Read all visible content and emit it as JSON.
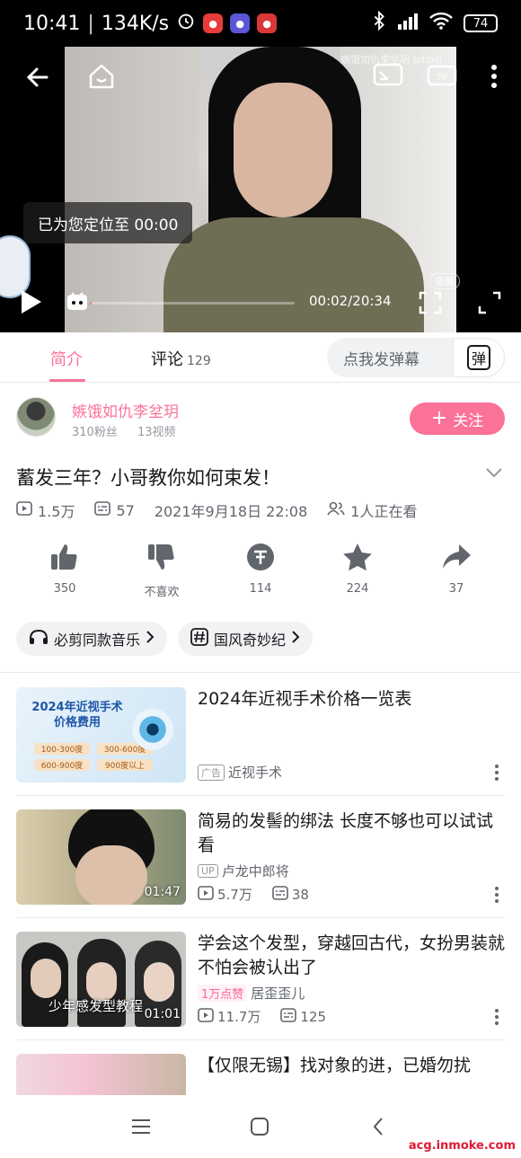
{
  "status_bar": {
    "time": "10:41",
    "speed": "134K/s",
    "battery": "74"
  },
  "player": {
    "watermark": "嫉饿如仇李坌玥 bilibili",
    "toast": "已为您定位至 00:00",
    "time_display": "00:02/20:34",
    "progress": 0.002,
    "portrait_label": "竖屏"
  },
  "tabs": {
    "intro": "简介",
    "comments": "评论",
    "comments_count": "129",
    "danmaku_placeholder": "点我发弹幕",
    "danmaku_button": "弹"
  },
  "uploader": {
    "name": "嫉饿如仇李坌玥",
    "fans": "310粉丝",
    "videos": "13视频",
    "follow_label": "关注"
  },
  "video_info": {
    "title": "蓄发三年？小哥教你如何束发！",
    "views": "1.5万",
    "danmaku": "57",
    "date": "2021年9月18日 22:08",
    "watching": "1人正在看"
  },
  "actions": [
    {
      "icon": "thumbs-up-icon",
      "label": "350"
    },
    {
      "icon": "thumbs-down-icon",
      "label": "不喜欢"
    },
    {
      "icon": "coin-icon",
      "label": "114"
    },
    {
      "icon": "star-icon",
      "label": "224"
    },
    {
      "icon": "share-icon",
      "label": "37"
    }
  ],
  "chips": [
    {
      "icon": "music-icon",
      "label": "必剪同款音乐"
    },
    {
      "icon": "hashtag-icon",
      "label": "国风奇妙纪"
    }
  ],
  "recommendations": [
    {
      "title": "2024年近视手术价格一览表",
      "ad_tag": "广告",
      "subtitle": "近视手术",
      "thumb_title": "2024年近视手术\n价格费用",
      "thumb_prices": [
        "100-300度",
        "300-600度",
        "600-900度",
        "900度以上"
      ]
    },
    {
      "title": "简易的发髻的绑法 长度不够也可以试试看",
      "up_tag": "UP",
      "author": "卢龙中郎将",
      "views": "5.7万",
      "danmaku": "38",
      "duration": "01:47"
    },
    {
      "title": "学会这个发型，穿越回古代，女扮男装就不怕会被认出了",
      "hot_tag": "1万点赞",
      "author": "居歪歪儿",
      "views": "11.7万",
      "danmaku": "125",
      "duration": "01:01",
      "thumb_caption": "少年感发型教程"
    },
    {
      "title": "【仅限无锡】找对象的进，已婚勿扰"
    }
  ],
  "site_watermark": "acg.inmoke.com"
}
